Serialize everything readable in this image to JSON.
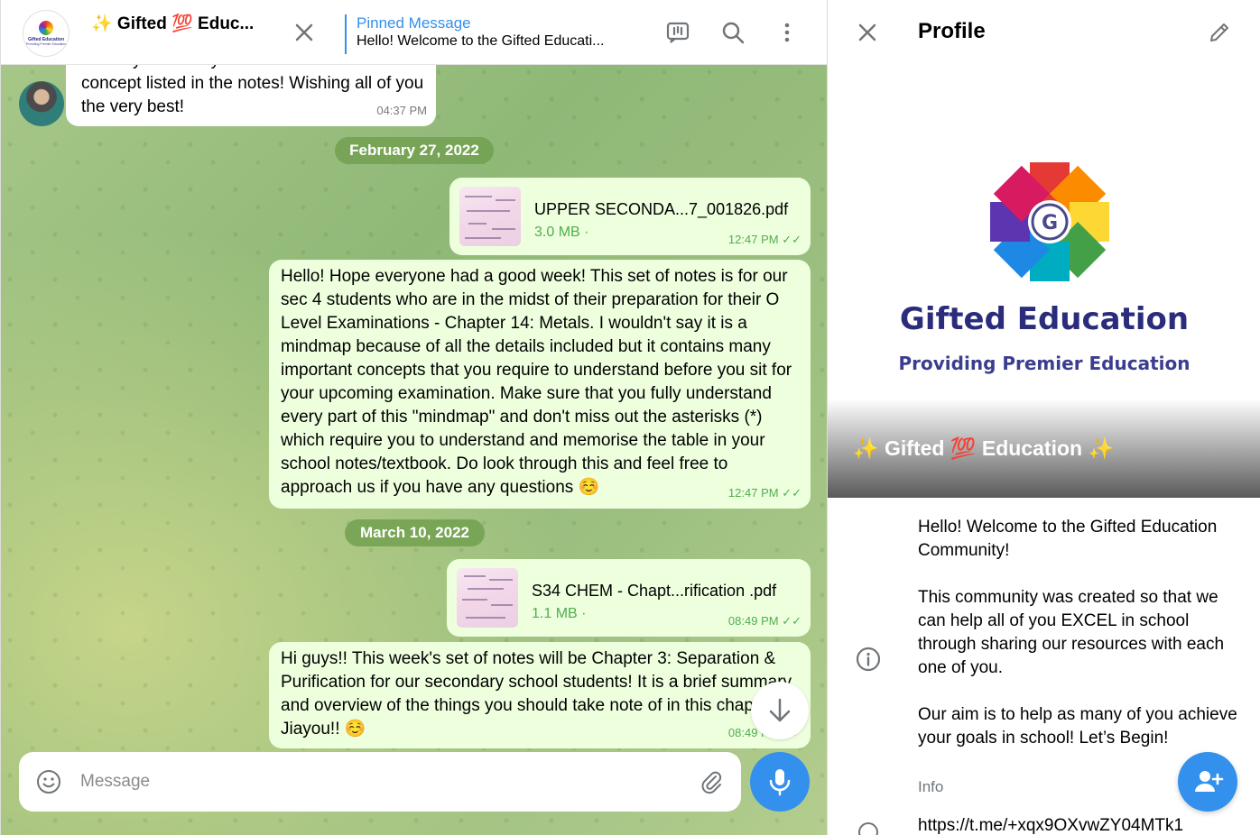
{
  "header": {
    "chat_title": "✨ Gifted 💯 Educ...",
    "avatar_title": "Gifted Education",
    "avatar_subtitle": "Providing Premier Education",
    "pinned_label": "Pinned Message",
    "pinned_text": "Hello! Welcome to the Gifted Educati..."
  },
  "messages": {
    "m0": {
      "line0": "to test yourself if you are familiar with each",
      "text": "concept listed in the notes! Wishing all of you the very best!",
      "time": "04:37 PM"
    },
    "date1": "February 27, 2022",
    "m1": {
      "file": "UPPER SECONDA...7_001826.pdf",
      "size": "3.0 MB ·",
      "time": "12:47 PM"
    },
    "m2": {
      "text": "Hello! Hope everyone had a good week! This set of notes is for our sec 4 students who are in the midst of their preparation for their O Level Examinations - Chapter 14: Metals. I wouldn't say it is a mindmap because of all the details included but it contains many important concepts that you require to understand before you sit for your upcoming examination. Make sure that you fully understand every part of this \"mindmap\" and don't miss out the asterisks (*) which require you to understand and memorise the table in your school notes/textbook. Do look through this and feel free to approach us if you have any questions ☺️",
      "time": "12:47 PM"
    },
    "date2": "March 10, 2022",
    "m3": {
      "file": "S34 CHEM - Chapt...rification .pdf",
      "size": "1.1 MB ·",
      "time": "08:49 PM"
    },
    "m4": {
      "text": "Hi guys!! This week's set of notes will be Chapter 3: Separation & Purification for our secondary school students! It is a brief summary and overview of the things you should take note of in this chapter. Jiayou!! ☺️",
      "time": "08:49 PM"
    }
  },
  "composer": {
    "placeholder": "Message"
  },
  "profile": {
    "title": "Profile",
    "brand_title": "Gifted Education",
    "brand_subtitle": "Providing Premier Education",
    "channel_name": "✨ Gifted 💯 Education ✨",
    "description": "Hello! Welcome to the Gifted Education Community!\n\nThis community was created so that we can help all of you EXCEL in school through sharing our resources with each one of you.\n\nOur aim is to help as many of you achieve your goals in school! Let’s Begin!",
    "info_label": "Info",
    "link": "https://t.me/+xqx9OXvwZY04MTk1"
  },
  "colors": {
    "accent": "#3390ec",
    "outgoing_bubble": "#eeffde",
    "check": "#4fae4e"
  }
}
